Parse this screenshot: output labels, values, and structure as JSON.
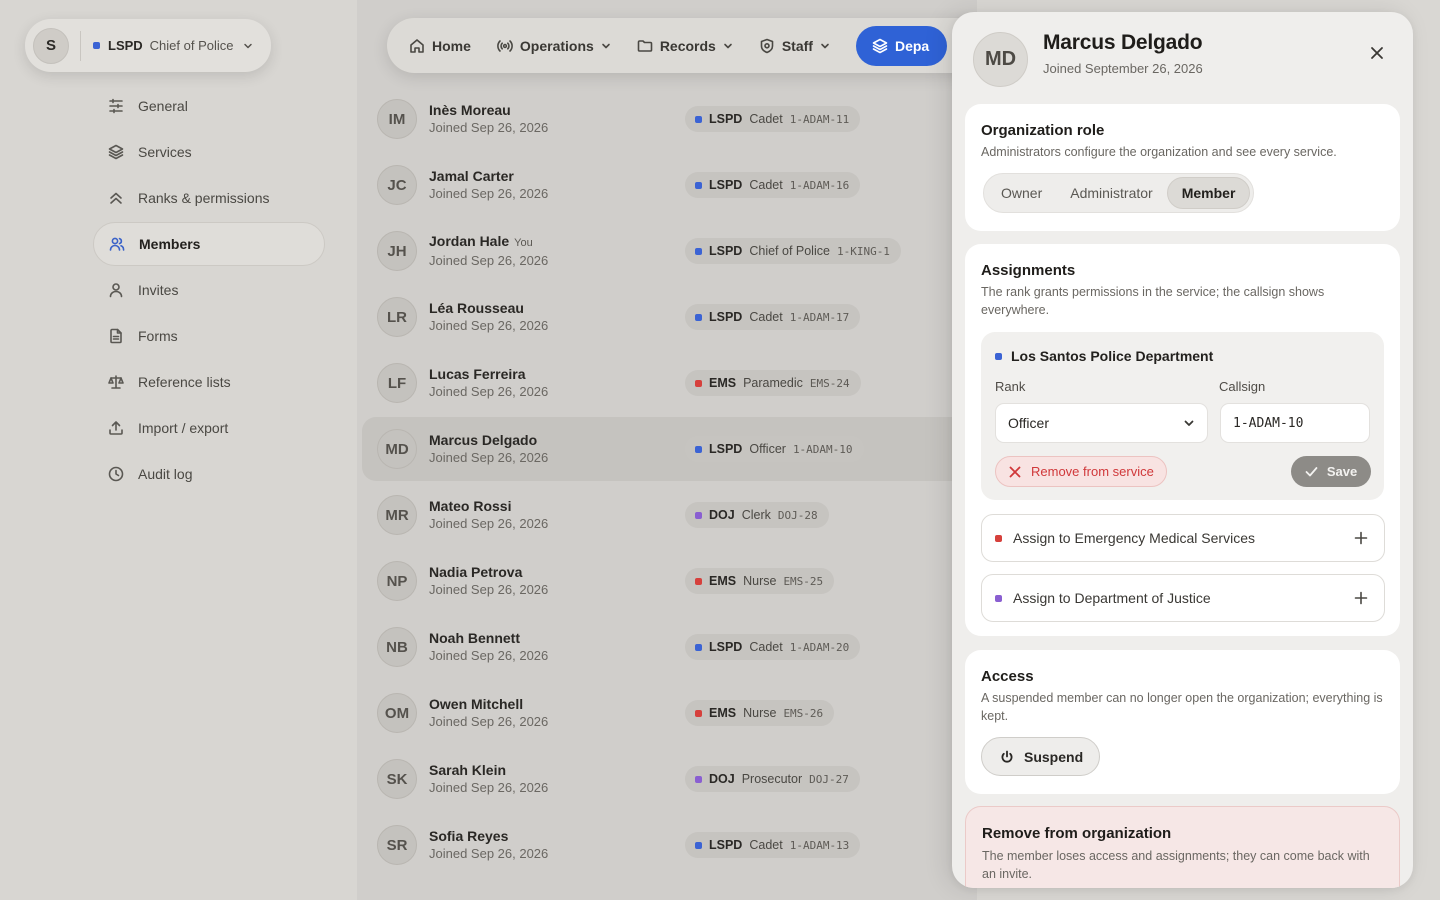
{
  "org": {
    "initial": "S",
    "service": "LSPD",
    "service_color": "#3b63d4",
    "rank": "Chief of Police"
  },
  "sidebar": {
    "items": [
      {
        "label": "General",
        "icon": "sliders-icon"
      },
      {
        "label": "Services",
        "icon": "layers-icon"
      },
      {
        "label": "Ranks & permissions",
        "icon": "chevrons-up-icon"
      },
      {
        "label": "Members",
        "icon": "users-icon",
        "active": true
      },
      {
        "label": "Invites",
        "icon": "user-icon"
      },
      {
        "label": "Forms",
        "icon": "file-icon"
      },
      {
        "label": "Reference lists",
        "icon": "scale-icon"
      },
      {
        "label": "Import / export",
        "icon": "upload-icon"
      },
      {
        "label": "Audit log",
        "icon": "clock-icon"
      }
    ]
  },
  "topnav": {
    "items": [
      {
        "label": "Home",
        "icon": "home-icon",
        "has_dropdown": false
      },
      {
        "label": "Operations",
        "icon": "radio-icon",
        "has_dropdown": true
      },
      {
        "label": "Records",
        "icon": "folder-icon",
        "has_dropdown": true
      },
      {
        "label": "Staff",
        "icon": "badge-icon",
        "has_dropdown": true
      }
    ],
    "active_label": "Depa",
    "active_icon": "layers-icon"
  },
  "colors": {
    "lspd": "#3b63d4",
    "ems": "#d6403c",
    "doj": "#8a5fd1",
    "accent": "#2f62d6"
  },
  "members": [
    {
      "initials": "IM",
      "name": "Inès Moreau",
      "you": "",
      "joined": "Joined Sep 26, 2026",
      "service": "LSPD",
      "rank": "Cadet",
      "callsign": "1-ADAM-11",
      "color": "#3b63d4"
    },
    {
      "initials": "JC",
      "name": "Jamal Carter",
      "you": "",
      "joined": "Joined Sep 26, 2026",
      "service": "LSPD",
      "rank": "Cadet",
      "callsign": "1-ADAM-16",
      "color": "#3b63d4"
    },
    {
      "initials": "JH",
      "name": "Jordan Hale",
      "you": "You",
      "joined": "Joined Sep 26, 2026",
      "service": "LSPD",
      "rank": "Chief of Police",
      "callsign": "1-KING-1",
      "color": "#3b63d4"
    },
    {
      "initials": "LR",
      "name": "Léa Rousseau",
      "you": "",
      "joined": "Joined Sep 26, 2026",
      "service": "LSPD",
      "rank": "Cadet",
      "callsign": "1-ADAM-17",
      "color": "#3b63d4"
    },
    {
      "initials": "LF",
      "name": "Lucas Ferreira",
      "you": "",
      "joined": "Joined Sep 26, 2026",
      "service": "EMS",
      "rank": "Paramedic",
      "callsign": "EMS-24",
      "color": "#d6403c"
    },
    {
      "initials": "MD",
      "name": "Marcus Delgado",
      "you": "",
      "joined": "Joined Sep 26, 2026",
      "service": "LSPD",
      "rank": "Officer",
      "callsign": "1-ADAM-10",
      "color": "#3b63d4",
      "selected": true
    },
    {
      "initials": "MR",
      "name": "Mateo Rossi",
      "you": "",
      "joined": "Joined Sep 26, 2026",
      "service": "DOJ",
      "rank": "Clerk",
      "callsign": "DOJ-28",
      "color": "#8a5fd1"
    },
    {
      "initials": "NP",
      "name": "Nadia Petrova",
      "you": "",
      "joined": "Joined Sep 26, 2026",
      "service": "EMS",
      "rank": "Nurse",
      "callsign": "EMS-25",
      "color": "#d6403c"
    },
    {
      "initials": "NB",
      "name": "Noah Bennett",
      "you": "",
      "joined": "Joined Sep 26, 2026",
      "service": "LSPD",
      "rank": "Cadet",
      "callsign": "1-ADAM-20",
      "color": "#3b63d4"
    },
    {
      "initials": "OM",
      "name": "Owen Mitchell",
      "you": "",
      "joined": "Joined Sep 26, 2026",
      "service": "EMS",
      "rank": "Nurse",
      "callsign": "EMS-26",
      "color": "#d6403c"
    },
    {
      "initials": "SK",
      "name": "Sarah Klein",
      "you": "",
      "joined": "Joined Sep 26, 2026",
      "service": "DOJ",
      "rank": "Prosecutor",
      "callsign": "DOJ-27",
      "color": "#8a5fd1"
    },
    {
      "initials": "SR",
      "name": "Sofia Reyes",
      "you": "",
      "joined": "Joined Sep 26, 2026",
      "service": "LSPD",
      "rank": "Cadet",
      "callsign": "1-ADAM-13",
      "color": "#3b63d4"
    }
  ],
  "drawer": {
    "initials": "MD",
    "name": "Marcus Delgado",
    "joined": "Joined September 26, 2026",
    "role": {
      "title": "Organization role",
      "desc": "Administrators configure the organization and see every service.",
      "options": [
        "Owner",
        "Administrator",
        "Member"
      ],
      "selected": "Member"
    },
    "assignments": {
      "title": "Assignments",
      "desc": "The rank grants permissions in the service; the callsign shows everywhere.",
      "current": {
        "service": "Los Santos Police Department",
        "rank_label": "Rank",
        "rank_value": "Officer",
        "callsign_label": "Callsign",
        "callsign_value": "1-ADAM-10",
        "remove_label": "Remove from service",
        "save_label": "Save"
      },
      "assign_ems": "Assign to Emergency Medical Services",
      "assign_doj": "Assign to Department of Justice"
    },
    "access": {
      "title": "Access",
      "desc": "A suspended member can no longer open the organization; everything is kept.",
      "suspend_label": "Suspend"
    },
    "danger": {
      "title": "Remove from organization",
      "desc": "The member loses access and assignments; they can come back with an invite."
    }
  }
}
